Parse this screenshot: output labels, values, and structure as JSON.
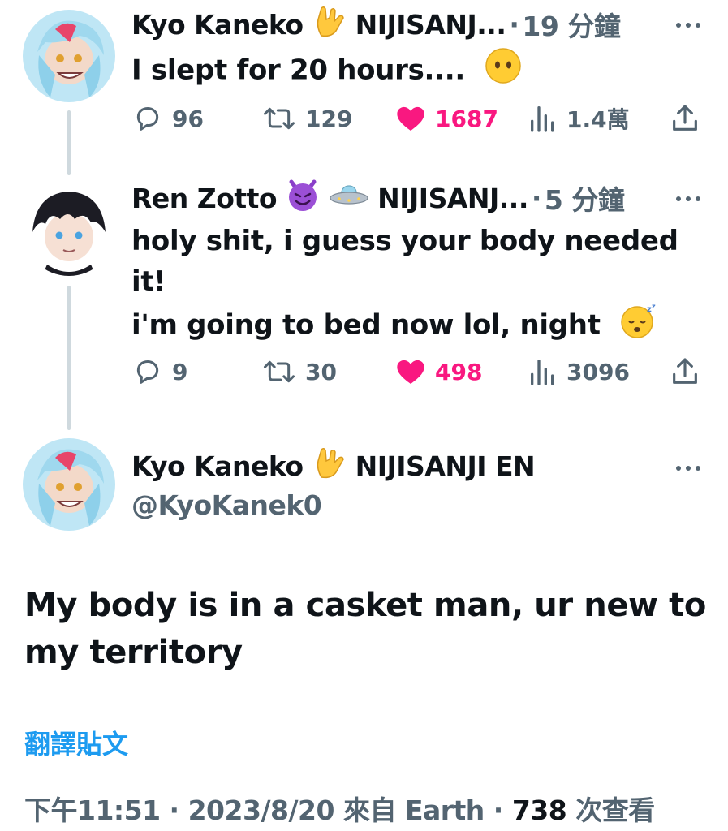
{
  "tweets": [
    {
      "display_name": "Kyo Kaneko",
      "org": "NIJISANJ...",
      "separator": "·",
      "time": "19 分鐘",
      "text_lines": [
        "I slept for 20 hours...."
      ],
      "stats": {
        "replies": "96",
        "retweets": "129",
        "likes": "1687",
        "views": "1.4萬"
      }
    },
    {
      "display_name": "Ren Zotto",
      "org": "NIJISANJ...",
      "separator": "·",
      "time": "5 分鐘",
      "text_lines": [
        "holy shit, i guess your body needed",
        "it!",
        "i'm going to bed now lol, night"
      ],
      "stats": {
        "replies": "9",
        "retweets": "30",
        "likes": "498",
        "views": "3096"
      }
    }
  ],
  "main": {
    "display_name": "Kyo Kaneko",
    "org": "NIJISANJI EN",
    "handle": "@KyoKanek0",
    "text": "My body is in a casket man, ur new to my territory",
    "translate": "翻譯貼文",
    "time": "下午11:51",
    "date": "2023/8/20",
    "source_prefix": "來自",
    "source": "Earth",
    "views_count": "738",
    "views_label": "次查看",
    "sep": "·"
  },
  "colors": {
    "text": "#0f1419",
    "secondary": "#536471",
    "like": "#f91880",
    "link": "#1d9bf0",
    "thread_line": "#cfd9de"
  },
  "icons": [
    "reply-icon",
    "retweet-icon",
    "heart-icon",
    "views-icon",
    "share-icon",
    "more-icon"
  ]
}
